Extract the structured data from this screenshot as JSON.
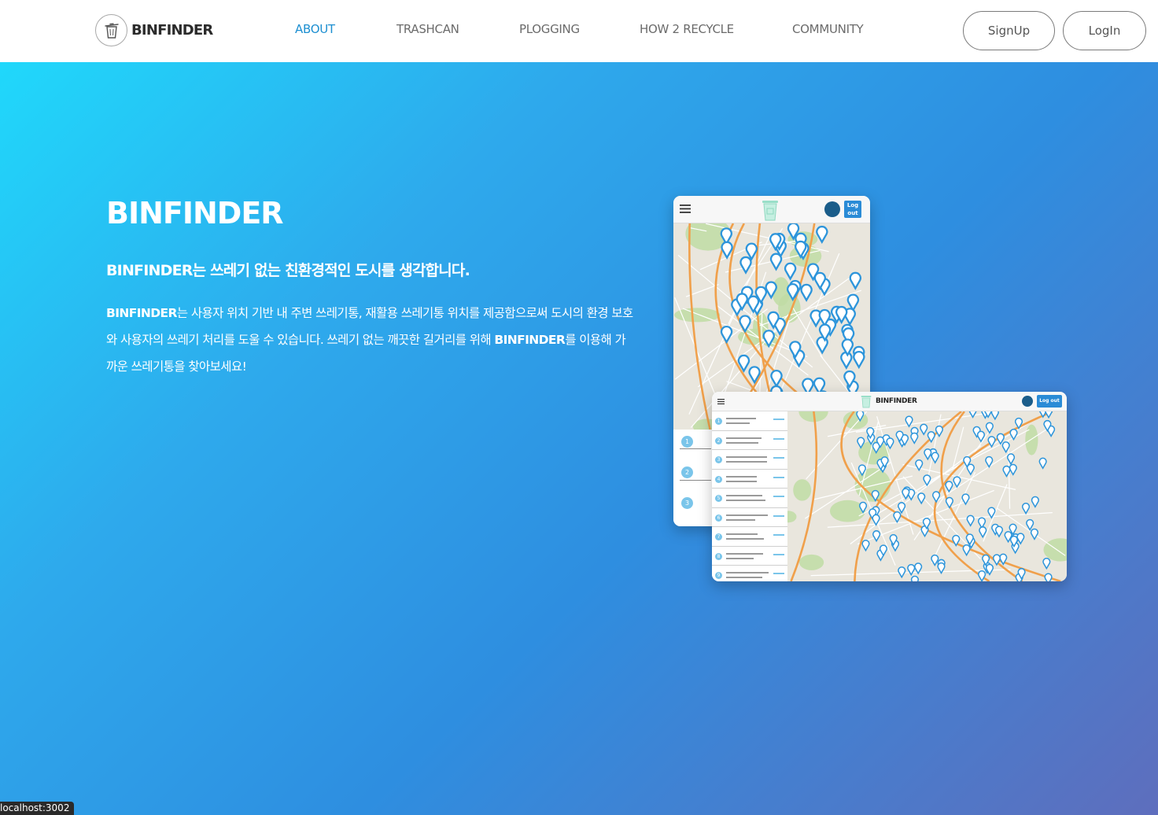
{
  "header": {
    "logo_text": "BINFINDER",
    "nav": [
      "ABOUT",
      "TRASHCAN",
      "PLOGGING",
      "HOW 2 RECYCLE",
      "COMMUNITY"
    ],
    "active_nav": "ABOUT",
    "signup_label": "SignUp",
    "login_label": "LogIn"
  },
  "hero": {
    "title": "BINFINDER",
    "subtitle_brand": "BINFINDER",
    "subtitle_rest": "는 쓰레기 없는 친환경적인 도시를 생각합니다.",
    "desc_brand1": "BINFINDER",
    "desc_part1": "는 사용자 위치 기반 내 주변 쓰레기통, 재활용 쓰레기통 위치를 제공함으로써 도시의 환경 보호와 사용자의 쓰레기 처리를 도울 수 있습니다. 쓰레기 없는 깨끗한 길거리를 위해 ",
    "desc_brand2": "BINFINDER",
    "desc_part2": "를 이용해 가까운 쓰레기통을 찾아보세요!"
  },
  "mockups": {
    "mobile_logout": "Log out",
    "desktop_title": "BINFINDER",
    "desktop_logout": "Log out",
    "mobile_list_nums": [
      "1",
      "2",
      "3"
    ],
    "desktop_list_nums": [
      "1",
      "2",
      "3",
      "4",
      "5",
      "6",
      "7",
      "8",
      "9"
    ]
  },
  "status_bar": {
    "url": "localhost:3002"
  },
  "colors": {
    "nav_active": "#1d8fd1",
    "gradient_start": "#20d8fb",
    "gradient_end": "#5e6ebd",
    "pin": "#2d95db"
  },
  "icons": [
    "trash-bin-logo-icon",
    "hamburger-menu-icon",
    "map-pin-icon",
    "user-avatar-icon"
  ]
}
